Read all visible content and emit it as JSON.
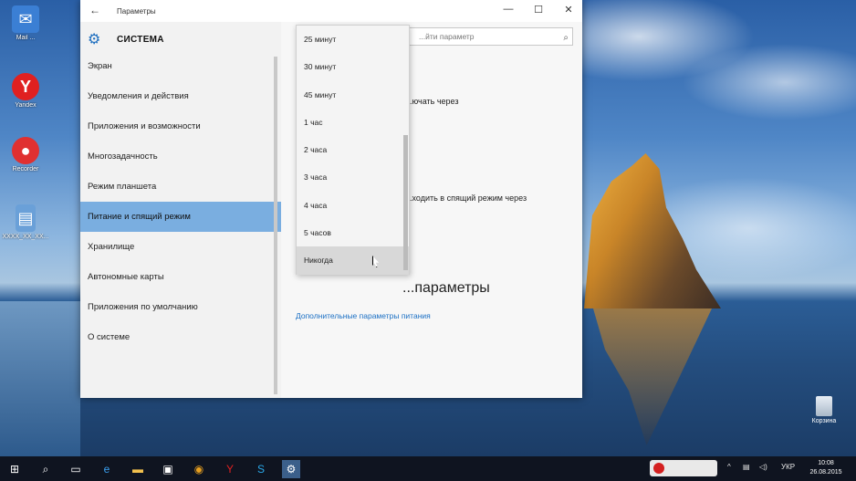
{
  "desktop_icons": [
    {
      "label": "Mail ...",
      "icon": "mail-app-icon",
      "color": "#3b7fd4"
    },
    {
      "label": "Yandex",
      "icon": "yandex-browser-icon",
      "color": "#e02020"
    },
    {
      "label": "Recorder",
      "icon": "recorder-app-icon",
      "color": "#e03030"
    },
    {
      "label": "XXXX_XX_XX...",
      "icon": "document-file-icon",
      "color": "#6aa0d8"
    }
  ],
  "window": {
    "title": "Параметры",
    "back": "←",
    "minimize": "—",
    "maximize": "☐",
    "close": "✕"
  },
  "sidebar": {
    "header": "СИСТЕМА",
    "items": [
      {
        "label": "Экран"
      },
      {
        "label": "Уведомления и действия"
      },
      {
        "label": "Приложения и возможности"
      },
      {
        "label": "Многозадачность"
      },
      {
        "label": "Режим планшета"
      },
      {
        "label": "Питание и спящий режим",
        "active": true
      },
      {
        "label": "Хранилище"
      },
      {
        "label": "Автономные карты"
      },
      {
        "label": "Приложения по умолчанию"
      },
      {
        "label": "О системе"
      }
    ]
  },
  "content": {
    "search_placeholder": "...йти параметр",
    "text_1": "...ючать через",
    "text_2": "...ходить в спящий режим через",
    "section_heading": "...параметры",
    "link": "Дополнительные параметры питания"
  },
  "dropdown": {
    "options": [
      {
        "label": "25 минут"
      },
      {
        "label": "30 минут"
      },
      {
        "label": "45 минут"
      },
      {
        "label": "1 час"
      },
      {
        "label": "2 часа"
      },
      {
        "label": "3 часа"
      },
      {
        "label": "4 часа"
      },
      {
        "label": "5 часов"
      },
      {
        "label": "Никогда",
        "hovered": true
      }
    ]
  },
  "recycle_bin": {
    "label": "Корзина"
  },
  "taskbar": {
    "language": "УКР",
    "time": "10:08",
    "date": "26.08.2015",
    "apps": [
      "windows-start-icon",
      "search-icon",
      "task-view-icon",
      "edge-icon",
      "file-explorer-icon",
      "store-icon",
      "chrome-icon",
      "yandex-icon",
      "skype-icon",
      "settings-gear-icon"
    ]
  }
}
